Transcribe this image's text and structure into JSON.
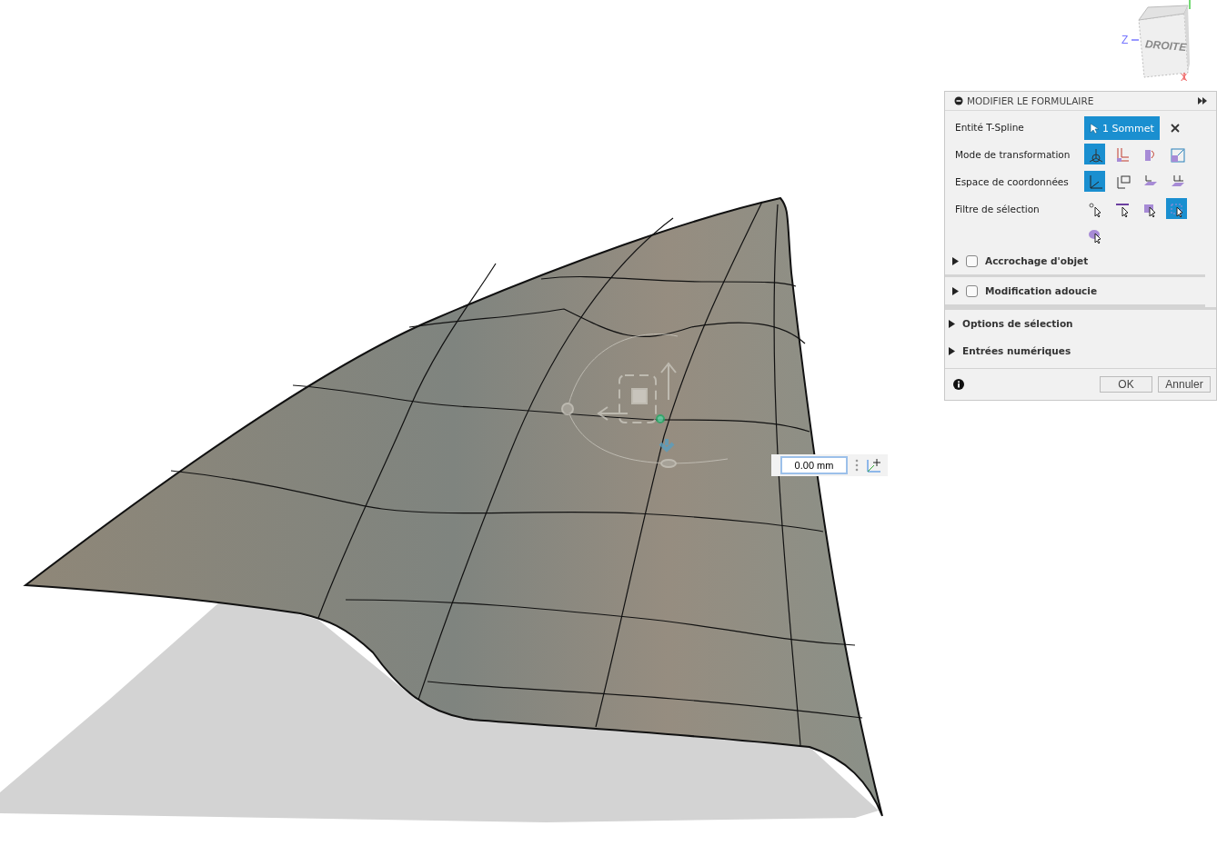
{
  "view_cube": {
    "face": "DROITE",
    "axis_labels": [
      "Z",
      "X"
    ]
  },
  "dimension_input": {
    "value": "0.00 mm"
  },
  "panel": {
    "title": "MODIFIER LE FORMULAIRE",
    "rows": [
      {
        "label": "Entité T-Spline",
        "kind": "selection",
        "value": "1 Sommet"
      },
      {
        "label": "Mode de transformation",
        "kind": "icons",
        "options": [
          {
            "selected": true
          },
          {
            "selected": false
          },
          {
            "selected": false
          },
          {
            "selected": false
          }
        ]
      },
      {
        "label": "Espace de coordonnées",
        "kind": "icons",
        "options": [
          {
            "selected": true
          },
          {
            "selected": false
          },
          {
            "selected": false
          },
          {
            "selected": false
          }
        ]
      },
      {
        "label": "Filtre de sélection",
        "kind": "icons",
        "options": [
          {
            "selected": false
          },
          {
            "selected": false
          },
          {
            "selected": false
          },
          {
            "selected": true
          },
          {
            "selected": false
          }
        ]
      }
    ],
    "sections": [
      {
        "label": "Accrochage d'objet",
        "kind": "checkbox",
        "checked": false,
        "expanded": false
      },
      {
        "label": "Modification adoucie",
        "kind": "checkbox",
        "checked": false,
        "expanded": false
      },
      {
        "label": "Options de sélection",
        "kind": "plain",
        "expanded": false
      },
      {
        "label": "Entrées numériques",
        "kind": "plain",
        "expanded": false
      }
    ],
    "buttons": [
      "OK",
      "Annuler"
    ]
  }
}
